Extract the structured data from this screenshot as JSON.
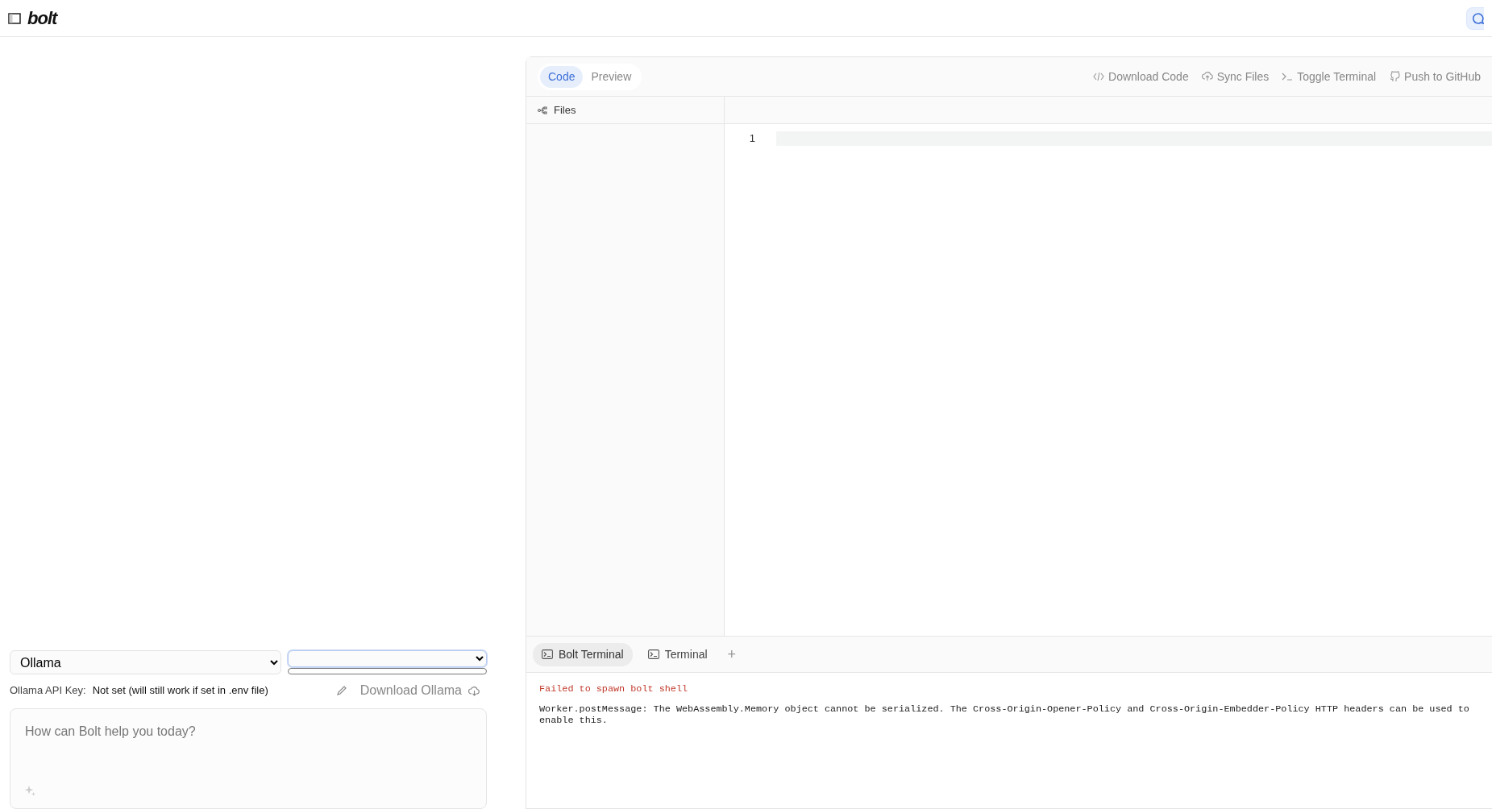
{
  "header": {
    "logo": "bolt"
  },
  "chat": {
    "provider_select": {
      "value": "Ollama"
    },
    "api_key": {
      "label": "Ollama API Key:",
      "value": "Not set (will still work if set in .env file)"
    },
    "download_link": "Download Ollama",
    "prompt": {
      "placeholder": "How can Bolt help you today?"
    }
  },
  "workbench": {
    "view_tabs": [
      {
        "label": "Code",
        "selected": true
      },
      {
        "label": "Preview",
        "selected": false
      }
    ],
    "actions": [
      {
        "kind": "code",
        "label": "Download Code"
      },
      {
        "kind": "sync",
        "label": "Sync Files"
      },
      {
        "kind": "terminal",
        "label": "Toggle Terminal"
      },
      {
        "kind": "github",
        "label": "Push to GitHub"
      }
    ],
    "files_title": "Files",
    "editor": {
      "line_numbers": [
        "1"
      ]
    },
    "terminal_tabs": [
      {
        "label": "Bolt Terminal",
        "selected": true
      },
      {
        "label": "Terminal",
        "selected": false
      }
    ],
    "add_tab": "+",
    "terminal_output": [
      {
        "kind": "error",
        "text": "Failed to spawn bolt shell"
      },
      {
        "kind": "plain",
        "text": "Worker.postMessage: The WebAssembly.Memory object cannot be serialized. The Cross-Origin-Opener-Policy and Cross-Origin-Embedder-Policy HTTP headers can be used to enable this."
      }
    ]
  }
}
